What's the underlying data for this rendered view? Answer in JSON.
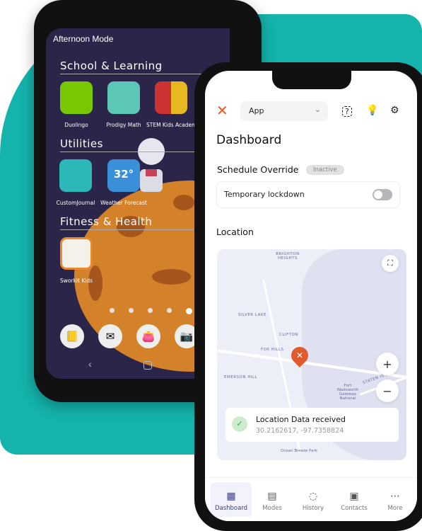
{
  "back_phone": {
    "mode_title": "Afternoon Mode",
    "sections": [
      {
        "title": "School & Learning",
        "apps": [
          "Duolingo",
          "Prodigy Math",
          "STEM Kids Academ"
        ]
      },
      {
        "title": "Utilities",
        "apps": [
          "CustomJournal",
          "Weather Forecast"
        ]
      },
      {
        "title": "Fitness & Health",
        "apps": [
          "Sworkit Kids"
        ]
      }
    ],
    "weather_temp": "32°",
    "dock_icons": [
      "contacts-icon",
      "mail-icon",
      "wallet-icon",
      "camera-icon"
    ]
  },
  "front_phone": {
    "header": {
      "app_select": "App"
    },
    "page_title": "Dashboard",
    "schedule_override": {
      "label": "Schedule Override",
      "badge": "Inactive",
      "toggle_label": "Temporary lockdown",
      "toggle_on": false
    },
    "location": {
      "title": "Location",
      "map_labels": [
        "BRIGHTON HEIGHTS",
        "SILVER LAKE",
        "CLIFTON",
        "FOX HILLS",
        "EMERSON HILL",
        "Fort Wadsworth Gateway National",
        "STATEN IS EXPY",
        "Ocean Breeze Park"
      ],
      "status_title": "Location Data received",
      "coords": "30.2162617, -97.7358824"
    },
    "nav": [
      {
        "label": "Dashboard",
        "icon": "grid-icon",
        "active": true
      },
      {
        "label": "Modes",
        "icon": "calendar-icon"
      },
      {
        "label": "History",
        "icon": "chat-icon"
      },
      {
        "label": "Contacts",
        "icon": "contact-card-icon"
      },
      {
        "label": "More",
        "icon": "more-icon"
      }
    ]
  },
  "colors": {
    "teal": "#14b3ac",
    "accent_orange": "#e05a2b",
    "nav_active": "#3b3b7a"
  }
}
